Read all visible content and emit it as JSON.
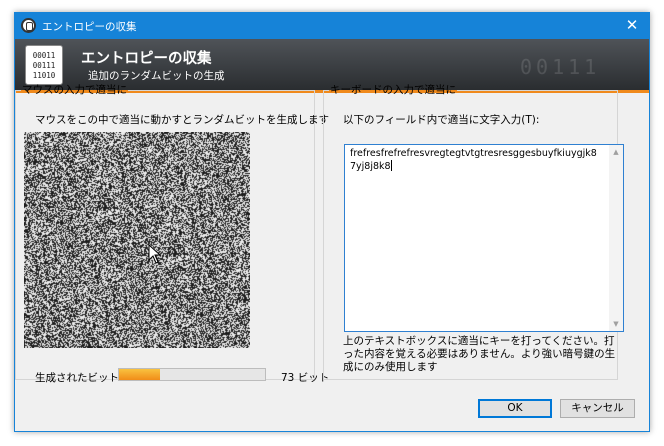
{
  "window": {
    "title": "エントロピーの収集",
    "close_glyph": "✕"
  },
  "banner": {
    "title": "エントロピーの収集",
    "subtitle": "追加のランダムビットの生成",
    "logo_lines": [
      "00011",
      "00111",
      "11010"
    ],
    "watermark": "00111"
  },
  "mouse_panel": {
    "legend": "マウスの入力で適当に",
    "description": "マウスをこの中で適当に動かすとランダムビットを生成します",
    "bits_label": "生成されたビット:",
    "bits_count": "73 ビット",
    "bits_progress_fraction": 0.28
  },
  "keyboard_panel": {
    "legend": "キーボードの入力で適当に",
    "description": "以下のフィールド内で適当に文字入力(T):",
    "input_value": "frefresfrefrefresvregtegtvtgtresresggesbuyfkiuygjk87yj8j8k8",
    "help_text": "上のテキストボックスに適当にキーを打ってください。打った内容を覚える必要はありません。より強い暗号鍵の生成にのみ使用します"
  },
  "buttons": {
    "ok": "OK",
    "cancel": "キャンセル"
  },
  "colors": {
    "titlebar": "#1683d8",
    "accent_orange": "#f08a1c",
    "banner_dark": "#2a2d30"
  }
}
